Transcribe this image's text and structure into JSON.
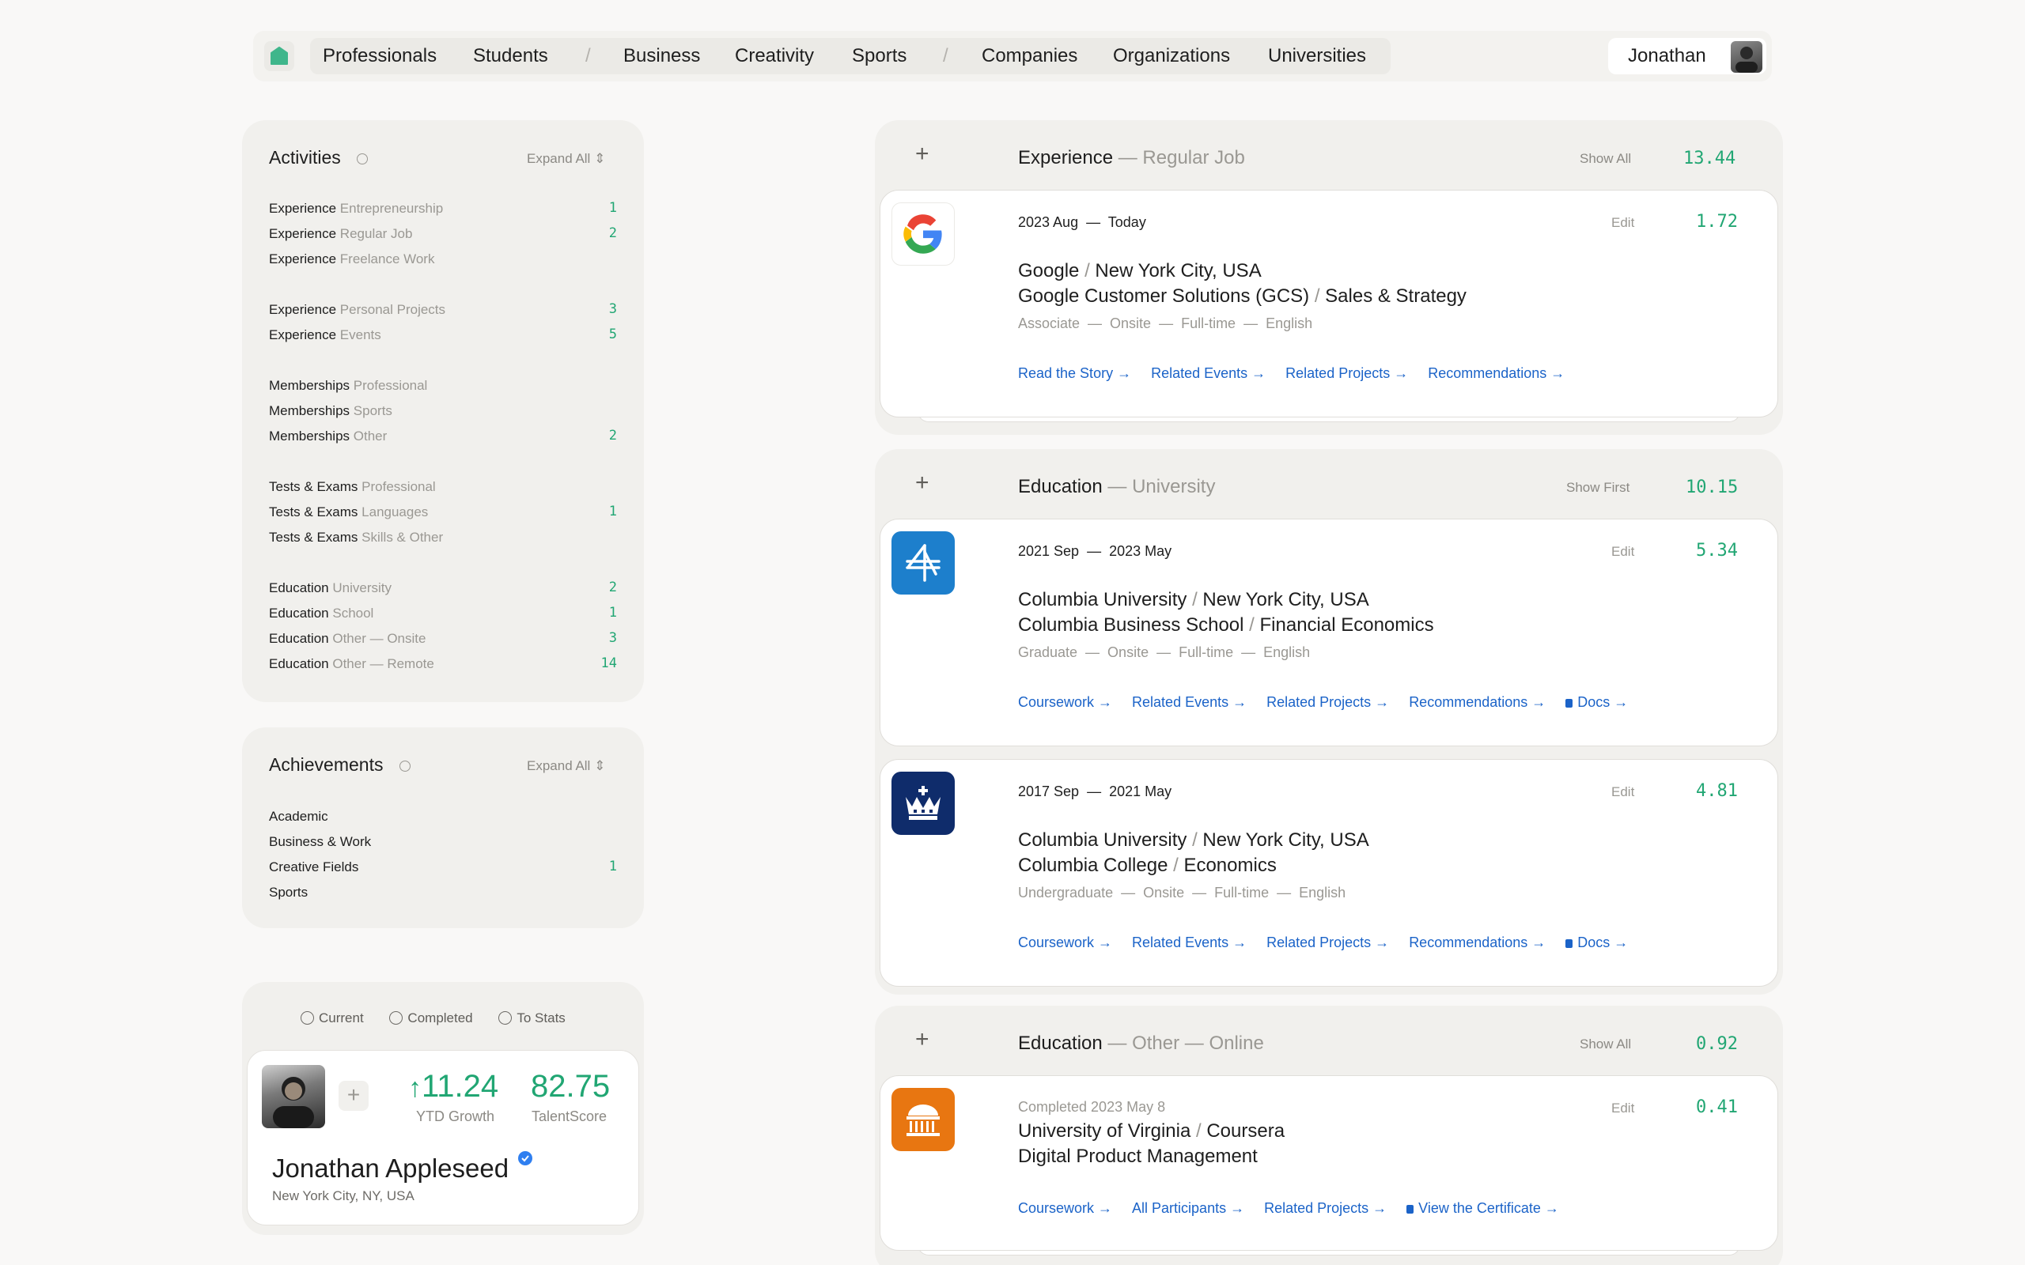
{
  "nav": {
    "items_group1": [
      "Professionals",
      "Students"
    ],
    "items_group2": [
      "Business",
      "Creativity",
      "Sports"
    ],
    "items_group3": [
      "Companies",
      "Organizations",
      "Universities"
    ],
    "separator": "/",
    "user_name": "Jonathan",
    "brand_color": "#3fb68b"
  },
  "activities": {
    "title": "Activities",
    "expand_label": "Expand All",
    "rows": [
      {
        "main": "Experience",
        "sub": "Entrepreneurship",
        "count": "1"
      },
      {
        "main": "Experience",
        "sub": "Regular Job",
        "count": "2"
      },
      {
        "main": "Experience",
        "sub": "Freelance Work",
        "count": ""
      },
      {
        "main": "Experience",
        "sub": "Personal Projects",
        "count": "3"
      },
      {
        "main": "Experience",
        "sub": "Events",
        "count": "5"
      },
      {
        "main": "Memberships",
        "sub": "Professional",
        "count": ""
      },
      {
        "main": "Memberships",
        "sub": "Sports",
        "count": ""
      },
      {
        "main": "Memberships",
        "sub": "Other",
        "count": "2"
      },
      {
        "main": "Tests & Exams",
        "sub": "Professional",
        "count": ""
      },
      {
        "main": "Tests & Exams",
        "sub": "Languages",
        "count": "1"
      },
      {
        "main": "Tests & Exams",
        "sub": "Skills & Other",
        "count": ""
      },
      {
        "main": "Education",
        "sub": "University",
        "count": "2"
      },
      {
        "main": "Education",
        "sub": "School",
        "count": "1"
      },
      {
        "main": "Education",
        "sub": "Other — Onsite",
        "count": "3"
      },
      {
        "main": "Education",
        "sub": "Other — Remote",
        "count": "14"
      }
    ]
  },
  "achievements": {
    "title": "Achievements",
    "expand_label": "Expand All",
    "rows": [
      {
        "main": "Academic",
        "count": ""
      },
      {
        "main": "Business & Work",
        "count": ""
      },
      {
        "main": "Creative Fields",
        "count": "1"
      },
      {
        "main": "Sports",
        "count": ""
      }
    ]
  },
  "profile": {
    "tabs": [
      "Current",
      "Completed",
      "To Stats"
    ],
    "add_label": "+",
    "ytd_growth": "11.24",
    "ytd_label": "YTD Growth",
    "talent_score": "82.75",
    "talent_label": "TalentScore",
    "name": "Jonathan Appleseed",
    "location": "New York City, NY, USA",
    "verified_color": "#2f7ff0"
  },
  "sections": {
    "experience": {
      "title": "Experience",
      "subtitle": "— Regular Job",
      "show_label": "Show All",
      "score": "13.44",
      "card": {
        "date_from": "2023 Aug",
        "date_sep": "—",
        "date_to": "Today",
        "edit": "Edit",
        "score": "1.72",
        "line1_a": "Google",
        "line1_b": "New York City, USA",
        "line2_a": "Google Customer Solutions (GCS)",
        "line2_b": "Sales & Strategy",
        "meta": "Associate  —  Onsite  —  Full-time  —  English",
        "links": [
          "Read the Story →",
          "Related Events →",
          "Related Projects →",
          "Recommendations →"
        ]
      }
    },
    "education_uni": {
      "title": "Education",
      "subtitle": "— University",
      "show_label": "Show First",
      "score": "10.15",
      "cards": [
        {
          "date_from": "2021 Sep",
          "date_sep": "—",
          "date_to": "2023 May",
          "edit": "Edit",
          "score": "5.34",
          "line1_a": "Columbia University",
          "line1_b": "New York City, USA",
          "line2_a": "Columbia Business School",
          "line2_b": "Financial Economics",
          "meta": "Graduate  —  Onsite  —  Full-time  —  English",
          "links": [
            "Coursework →",
            "Related Events →",
            "Related Projects →",
            "Recommendations →"
          ],
          "locked_link": "Docs →"
        },
        {
          "date_from": "2017 Sep",
          "date_sep": "—",
          "date_to": "2021 May",
          "edit": "Edit",
          "score": "4.81",
          "line1_a": "Columbia University",
          "line1_b": "New York City, USA",
          "line2_a": "Columbia College",
          "line2_b": "Economics",
          "meta": "Undergraduate  —  Onsite  —  Full-time  —  English",
          "links": [
            "Coursework →",
            "Related Events →",
            "Related Projects →",
            "Recommendations →"
          ],
          "locked_link": "Docs →"
        }
      ]
    },
    "education_online": {
      "title": "Education",
      "subtitle": "— Other — Online",
      "show_label": "Show All",
      "score": "0.92",
      "card": {
        "completed": "Completed 2023 May 8",
        "edit": "Edit",
        "score": "0.41",
        "line1_a": "University of Virginia",
        "line1_b": "Coursera",
        "line2_a": "Digital Product Management",
        "links": [
          "Coursework →",
          "All Participants →",
          "Related Projects →"
        ],
        "locked_link": "View the Certificate →"
      }
    }
  },
  "colors": {
    "accent_green": "#21a673",
    "link_blue": "#1b63c8",
    "columbia_biz_blue": "#1d7fcc",
    "columbia_navy": "#0f2c6b",
    "uva_orange": "#e87611"
  }
}
